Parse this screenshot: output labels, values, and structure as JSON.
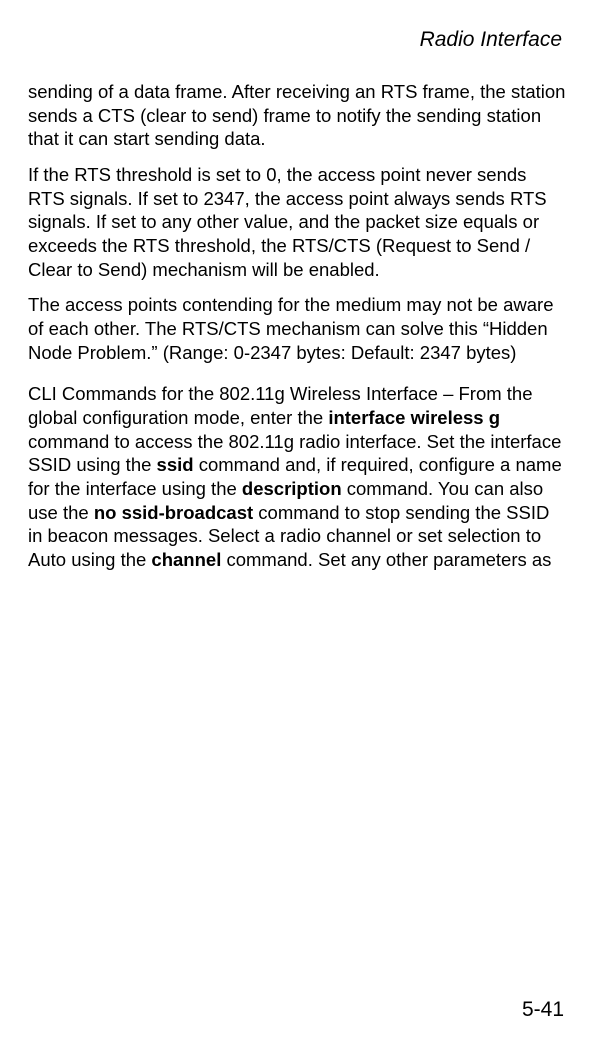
{
  "header": "Radio Interface",
  "para1": "sending of a data frame. After receiving an RTS frame, the station sends a CTS (clear to send) frame to notify the sending station that it can start sending data.",
  "para2": "If the RTS threshold is set to 0, the access point never sends RTS signals. If set to 2347, the access point always sends RTS signals. If set to any other value, and the packet size equals or exceeds the RTS threshold, the RTS/CTS (Request to Send / Clear to Send) mechanism will be enabled.",
  "para3": "The access points contending for the medium may not be aware of each other. The RTS/CTS mechanism can solve this “Hidden Node Problem.” (Range: 0-2347 bytes: Default: 2347 bytes)",
  "para4": {
    "seg1": "CLI Commands for the 802.11g Wireless Interface – From the global configuration mode, enter the ",
    "cmd1": "interface wireless g",
    "seg2": " command to access the 802.11g radio interface. Set the interface SSID using the ",
    "cmd2": "ssid",
    "seg3": " command and, if required, configure a name for the interface using the ",
    "cmd3": "description",
    "seg4": " command. You can also use the ",
    "cmd4": "no ssid-broadcast",
    "seg5": " command to stop sending the SSID in beacon messages. Select a radio channel or set selection to Auto using the ",
    "cmd5": "channel",
    "seg6": " command. Set any other parameters as"
  },
  "pageNumber": "5-41"
}
